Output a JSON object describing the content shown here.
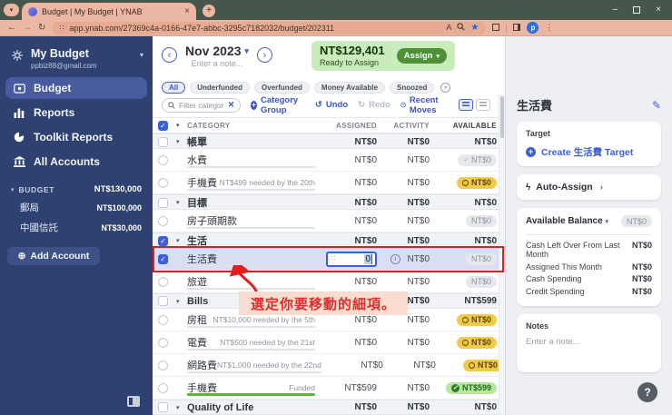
{
  "browser": {
    "tab_title": "Budget | My Budget | YNAB",
    "url": "app.ynab.com/27369c4a-0166-47e7-abbc-3295c7182032/budget/202311"
  },
  "sidebar": {
    "budget_name": "My Budget",
    "email": "ppbiz88@gmail.com",
    "nav": [
      {
        "label": "Budget"
      },
      {
        "label": "Reports"
      },
      {
        "label": "Toolkit Reports"
      },
      {
        "label": "All Accounts"
      }
    ],
    "section_label": "BUDGET",
    "section_total": "NT$130,000",
    "accounts": [
      {
        "name": "郵局",
        "amount": "NT$100,000"
      },
      {
        "name": "中國信託",
        "amount": "NT$30,000"
      }
    ],
    "add_account_label": "Add Account"
  },
  "month_header": {
    "month": "Nov 2023",
    "note_placeholder": "Enter a note...",
    "ready_amount": "NT$129,401",
    "ready_label": "Ready to Assign",
    "assign_label": "Assign"
  },
  "filters": {
    "items": [
      "All",
      "Underfunded",
      "Overfunded",
      "Money Available",
      "Snoozed"
    ],
    "selected": "All"
  },
  "toolbar": {
    "filter_placeholder": "Filter categories...",
    "category_group_label": "Category Group",
    "undo_label": "Undo",
    "redo_label": "Redo",
    "recent_moves_label": "Recent Moves"
  },
  "table": {
    "columns": [
      "CATEGORY",
      "ASSIGNED",
      "ACTIVITY",
      "AVAILABLE"
    ],
    "rows": [
      {
        "type": "group",
        "name": "帳單",
        "assigned": "NT$0",
        "activity": "NT$0",
        "available": "NT$0"
      },
      {
        "type": "category",
        "name": "水費",
        "goal": "",
        "assigned": "NT$0",
        "activity": "NT$0",
        "available": "NT$0",
        "available_state": "zero-check"
      },
      {
        "type": "category",
        "name": "手機費",
        "goal": "NT$499 needed by the 20th",
        "assigned": "NT$0",
        "activity": "NT$0",
        "available": "NT$0",
        "available_state": "underfunded"
      },
      {
        "type": "group",
        "name": "目標",
        "assigned": "NT$0",
        "activity": "NT$0",
        "available": "NT$0"
      },
      {
        "type": "category",
        "name": "房子頭期款",
        "goal": "",
        "assigned": "NT$0",
        "activity": "NT$0",
        "available": "NT$0",
        "available_state": "zero"
      },
      {
        "type": "group",
        "name": "生活",
        "assigned": "NT$0",
        "activity": "NT$0",
        "available": "NT$0",
        "checked": true
      },
      {
        "type": "category",
        "name": "生活費",
        "goal": "",
        "assigned_input": "0",
        "activity": "NT$0",
        "available": "NT$0",
        "available_state": "zero",
        "checked": true,
        "selected": true
      },
      {
        "type": "category",
        "name": "旅遊",
        "goal": "",
        "assigned": "NT$0",
        "activity": "NT$0",
        "available": "NT$0",
        "available_state": "zero"
      },
      {
        "type": "group",
        "name": "Bills",
        "assigned": "",
        "activity": "NT$0",
        "available": "NT$599"
      },
      {
        "type": "category",
        "name": "房租",
        "goal": "NT$10,000 needed by the 5th",
        "assigned": "NT$0",
        "activity": "NT$0",
        "available": "NT$0",
        "available_state": "underfunded"
      },
      {
        "type": "category",
        "name": "電費",
        "goal": "NT$500 needed by the 21st",
        "assigned": "NT$0",
        "activity": "NT$0",
        "available": "NT$0",
        "available_state": "underfunded"
      },
      {
        "type": "category",
        "name": "網路費",
        "goal": "NT$1,000 needed by the 22nd",
        "assigned": "NT$0",
        "activity": "NT$0",
        "available": "NT$0",
        "available_state": "underfunded"
      },
      {
        "type": "category",
        "name": "手機費",
        "goal": "Funded",
        "assigned": "NT$599",
        "activity": "NT$0",
        "available": "NT$599",
        "available_state": "funded"
      },
      {
        "type": "group",
        "name": "Quality of Life",
        "assigned": "NT$0",
        "activity": "NT$0",
        "available": "NT$0"
      }
    ]
  },
  "annotation": {
    "text": "選定你要移動的細項。"
  },
  "inspector": {
    "title": "生活費",
    "target_label": "Target",
    "create_target_label": "Create 生活費 Target",
    "auto_assign_label": "Auto-Assign",
    "available_balance_label": "Available Balance",
    "available_balance_amount": "NT$0",
    "breakdown": [
      {
        "label": "Cash Left Over From Last Month",
        "value": "NT$0"
      },
      {
        "label": "Assigned This Month",
        "value": "NT$0"
      },
      {
        "label": "Cash Spending",
        "value": "NT$0"
      },
      {
        "label": "Credit Spending",
        "value": "NT$0"
      }
    ],
    "notes_label": "Notes",
    "notes_placeholder": "Enter a note...",
    "help_label": "?"
  },
  "colors": {
    "accent_blue": "#3D5FD8",
    "sidebar_navy": "#2E4170",
    "ready_green_bg": "#C8ECBA",
    "assign_green": "#4E8F38",
    "underfunded_yellow": "#F2CA4A",
    "funded_green": "#B5E79F",
    "annotation_red": "#E02B2B",
    "chrome_salmon": "#ECB7A2",
    "chrome_dark": "#46564C"
  }
}
